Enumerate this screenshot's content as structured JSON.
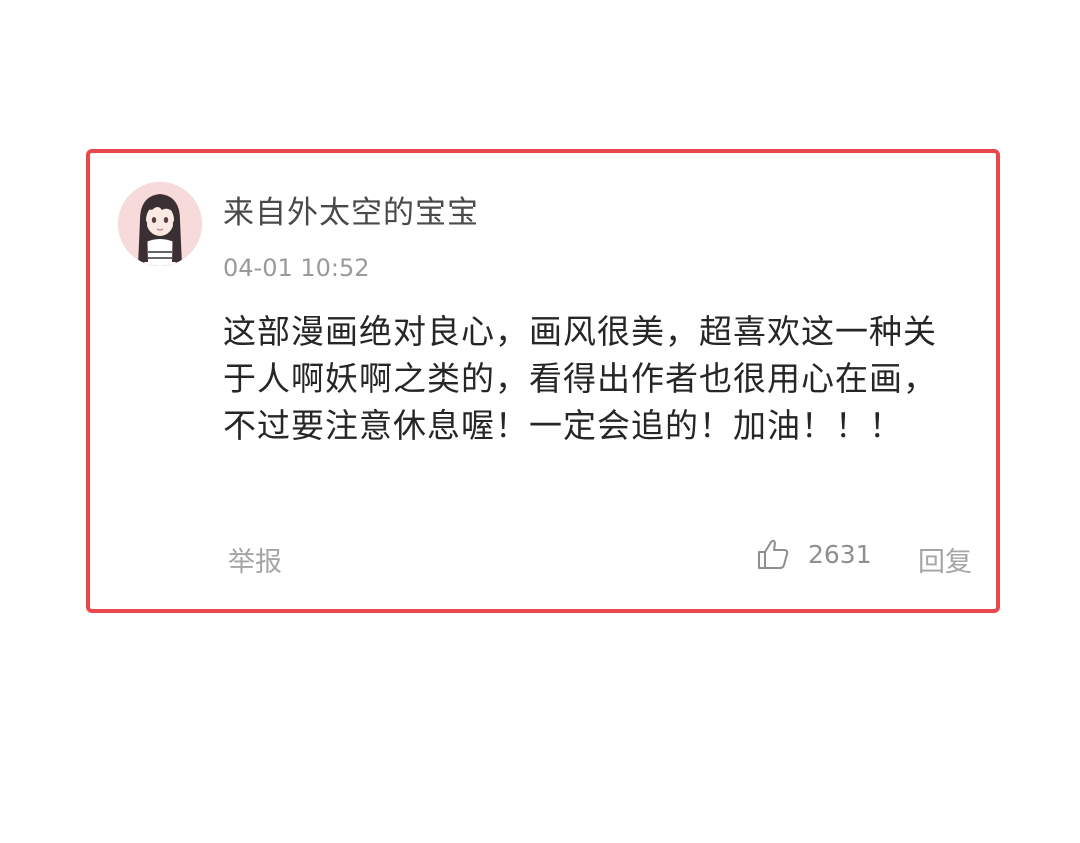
{
  "comment": {
    "avatar_icon": "anime-girl-avatar",
    "username": "来自外太空的宝宝",
    "timestamp": "04-01 10:52",
    "body": "这部漫画绝对良心，画风很美，超喜欢这一种关于人啊妖啊之类的，看得出作者也很用心在画，不过要注意休息喔！一定会追的！加油！！！",
    "actions": {
      "report_label": "举报",
      "like_icon": "thumbs-up-icon",
      "like_count": "2631",
      "reply_label": "回复"
    }
  },
  "colors": {
    "highlight_border": "#e8474b",
    "avatar_bg": "#f7dada"
  }
}
